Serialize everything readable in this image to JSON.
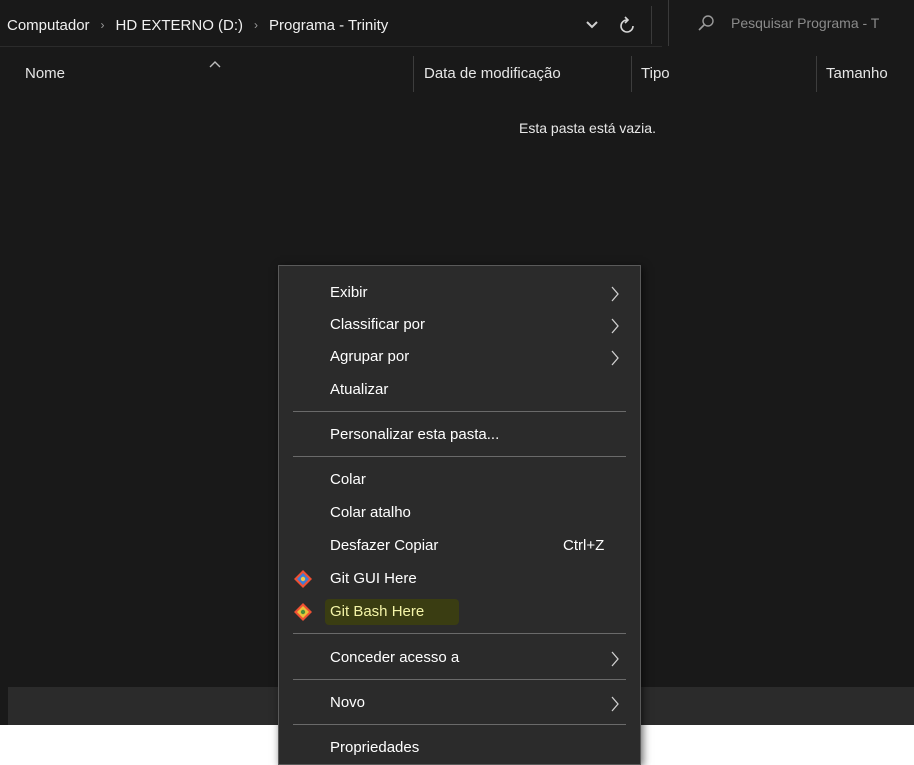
{
  "window": {
    "address_bar": {
      "breadcrumb": [
        "Computador",
        "HD EXTERNO (D:)",
        "Programa - Trinity"
      ],
      "search_placeholder": "Pesquisar Programa - T"
    },
    "columns": {
      "name": "Nome",
      "date_modified": "Data de modificação",
      "type": "Tipo",
      "size": "Tamanho"
    },
    "empty_message": "Esta pasta está vazia."
  },
  "context_menu": {
    "items": [
      {
        "label": "Exibir",
        "submenu": true
      },
      {
        "label": "Classificar por",
        "submenu": true
      },
      {
        "label": "Agrupar por",
        "submenu": true
      },
      {
        "label": "Atualizar"
      },
      {
        "label": "Personalizar esta pasta..."
      },
      {
        "label": "Colar"
      },
      {
        "label": "Colar atalho"
      },
      {
        "label": "Desfazer Copiar",
        "shortcut": "Ctrl+Z"
      },
      {
        "label": "Git GUI Here",
        "icon": "git-icon"
      },
      {
        "label": "Git Bash Here",
        "icon": "git-icon",
        "highlighted": true
      },
      {
        "label": "Conceder acesso a",
        "submenu": true
      },
      {
        "label": "Novo",
        "submenu": true
      },
      {
        "label": "Propriedades"
      }
    ]
  },
  "colors": {
    "background": "#191919",
    "menu_background": "#2b2b2b",
    "highlight": "#3a3d12",
    "text": "#ffffff"
  }
}
